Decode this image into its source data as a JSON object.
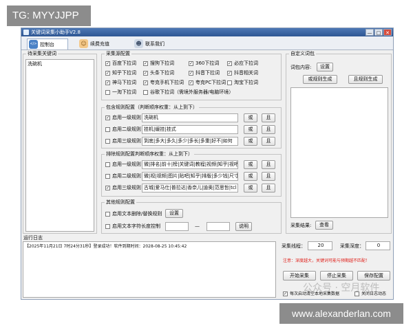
{
  "watermark_top": "TG: MYYJJPP",
  "watermark_bottom": "www.alexanderlan.com",
  "watermark_brand": "公众号 · 空月软件",
  "window": {
    "title": "关键词采集小助手V2.8",
    "min": "—",
    "max": "□",
    "close": "✕"
  },
  "tabs": [
    {
      "label": "控制台",
      "icon": "</>"
    },
    {
      "label": "续费充值",
      "icon": "☺"
    },
    {
      "label": "联系我们",
      "icon": "☻"
    }
  ],
  "keywords": {
    "title": "待采集关键词",
    "items": [
      "洗碗机"
    ]
  },
  "sources": {
    "title": "采集源配置",
    "options": [
      {
        "label": "百度下拉词",
        "checked": true
      },
      {
        "label": "搜狗下拉词",
        "checked": true
      },
      {
        "label": "360下拉词",
        "checked": true
      },
      {
        "label": "必应下拉词",
        "checked": true
      },
      {
        "label": "知乎下拉词",
        "checked": true
      },
      {
        "label": "头条下拉词",
        "checked": true
      },
      {
        "label": "抖音下拉词",
        "checked": true
      },
      {
        "label": "抖音相关词",
        "checked": true
      },
      {
        "label": "神马下拉词",
        "checked": true
      },
      {
        "label": "夸克手机下拉词",
        "checked": true
      },
      {
        "label": "夸克PC下拉词",
        "checked": true
      },
      {
        "label": "淘宝下拉词",
        "checked": false
      },
      {
        "label": "一淘下拉词",
        "checked": false
      },
      {
        "label": "谷歌下拉词（需境外服务器/电脑环境）",
        "checked": false
      }
    ]
  },
  "include_rules": {
    "title": "包含规则配置（判断顺序权重：从上到下）",
    "rows": [
      {
        "label": "启用一级规则",
        "checked": true,
        "value": "洗碗机"
      },
      {
        "label": "启用二级规则",
        "checked": false,
        "value": "挂机|缓挂|挂式"
      },
      {
        "label": "启用三级规则",
        "checked": false,
        "value": "到底|多大|多久|多少|多长|多重|好不|如何"
      }
    ]
  },
  "exclude_rules": {
    "title": "排除规则配置判断顺序权重：从上到下）",
    "rows": [
      {
        "label": "启用一级规则",
        "checked": false,
        "value": "微|排名|前十|榜|关键词|教程|视频|知乎|视吧"
      },
      {
        "label": "启用二级规则",
        "checked": false,
        "value": "微|视|视频|图片|贴吧|知乎|排版|多少钱|尺寸"
      },
      {
        "label": "启用三级规则",
        "checked": true,
        "value": "古城|爱马仕|普拉达|香奈儿|迪奥|范思哲|tcl"
      }
    ]
  },
  "rule_buttons": {
    "or": "或",
    "and": "且"
  },
  "other_rules": {
    "title": "其他规则配置",
    "replace_label": "启用文本删除/替换规则",
    "replace_checked": false,
    "settings_btn": "设置",
    "length_label": "启用文本字符长度控制",
    "length_checked": false,
    "length_min": "",
    "length_sep": "—",
    "length_max": "",
    "explain_btn": "说明"
  },
  "custom_dict": {
    "title": "自定义词包",
    "content_label": "词包内容:",
    "settings_btn": "设置",
    "or_gen": "或规则生成",
    "and_gen": "且规则生成",
    "result_label": "采集结果:",
    "view_btn": "查看"
  },
  "log": {
    "title": "运行日志",
    "line": "【2025年11月21日 7时24分31秒】登录成功！软件到期时间：2028-08-25 10:45:42"
  },
  "controls": {
    "threads_label": "采集线程：",
    "threads_value": "20",
    "depth_label": "采集深度：",
    "depth_value": "0",
    "warning": "注意：深度越大，关键词可能与预期越不匹配！",
    "start_btn": "开始采集",
    "stop_btn": "停止采集",
    "save_btn": "保存配置",
    "clear_label": "每次启动清空本地采集数据",
    "clear_checked": true,
    "close_log_label": "关闭日志动态",
    "close_log_checked": false
  },
  "colors": {
    "accent": "#2e5693",
    "warning": "#e0211b"
  }
}
